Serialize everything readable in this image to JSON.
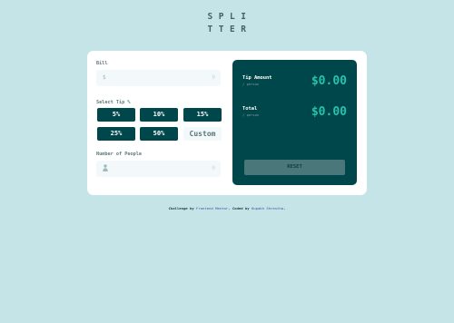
{
  "logo": {
    "line1": "SPLI",
    "line2": "TTER"
  },
  "bill": {
    "label": "Bill",
    "prefix": "$",
    "value": "0"
  },
  "tips": {
    "label": "Select Tip %",
    "options": [
      "5%",
      "10%",
      "15%",
      "25%",
      "50%"
    ],
    "custom": "Custom"
  },
  "people": {
    "label": "Number of People",
    "value": "0"
  },
  "results": {
    "tip_label": "Tip Amount",
    "tip_sub": "/ person",
    "tip_value": "$0.00",
    "total_label": "Total",
    "total_sub": "/ person",
    "total_value": "$0.00",
    "reset": "RESET"
  },
  "footer": {
    "prefix": "Challenge by ",
    "fm_link": "Frontend Mentor",
    "middle": ". Coded by ",
    "author": "Kupakh Shrestha",
    "suffix": "."
  },
  "colors": {
    "background": "#c5e4e7",
    "dark_green": "#00474b",
    "accent": "#26c2ae",
    "input_bg": "#f3f9fa"
  }
}
